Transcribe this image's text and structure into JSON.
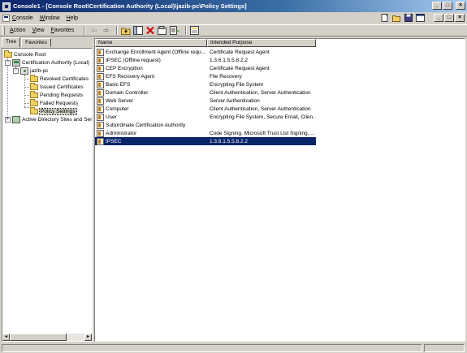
{
  "window": {
    "title": "Console1 - [Console Root\\Certification Authority (Local)\\jazib-pc\\Policy Settings]",
    "minimize": "_",
    "maximize": "□",
    "close": "×"
  },
  "menubar": {
    "items": [
      "Console",
      "Window",
      "Help"
    ]
  },
  "toolbar": {
    "menus": [
      "Action",
      "View",
      "Favorites"
    ],
    "back": "⇦",
    "forward": "⇨"
  },
  "tree": {
    "tabs": [
      "Tree",
      "Favorites"
    ],
    "root": "Console Root",
    "ca": "Certification Authority (Local)",
    "server": "jazib-pc",
    "folders": [
      "Revoked Certificates",
      "Issued Certificates",
      "Pending Requests",
      "Failed Requests",
      "Policy Settings"
    ],
    "ad": "Active Directory Sites and Ser"
  },
  "list": {
    "columns": [
      "Name",
      "Intended Purpose"
    ],
    "rows": [
      {
        "name": "Exchange Enrollment Agent (Offline requ...",
        "purpose": "Certificate Request Agent"
      },
      {
        "name": "IPSEC (Offline request)",
        "purpose": "1.3.6.1.5.5.8.2.2"
      },
      {
        "name": "CEP Encryption",
        "purpose": "Certificate Request Agent"
      },
      {
        "name": "EFS Recovery Agent",
        "purpose": "File Recovery"
      },
      {
        "name": "Basic EFS",
        "purpose": "Encrypting File System"
      },
      {
        "name": "Domain Controller",
        "purpose": "Client Authentication, Server Authentication"
      },
      {
        "name": "Web Server",
        "purpose": "Server Authentication"
      },
      {
        "name": "Computer",
        "purpose": "Client Authentication, Server Authentication"
      },
      {
        "name": "User",
        "purpose": "Encrypting File System, Secure Email, Clien..."
      },
      {
        "name": "Subordinate Certification Authority",
        "purpose": ""
      },
      {
        "name": "Administrator",
        "purpose": "Code Signing, Microsoft Trust List Signing, ..."
      },
      {
        "name": "IPSEC",
        "purpose": "1.3.6.1.5.5.8.2.2"
      }
    ],
    "selected_index": 11
  },
  "colors": {
    "titlebar": "#0a246a",
    "selection": "#0a246a",
    "chrome": "#d4d0c8"
  }
}
